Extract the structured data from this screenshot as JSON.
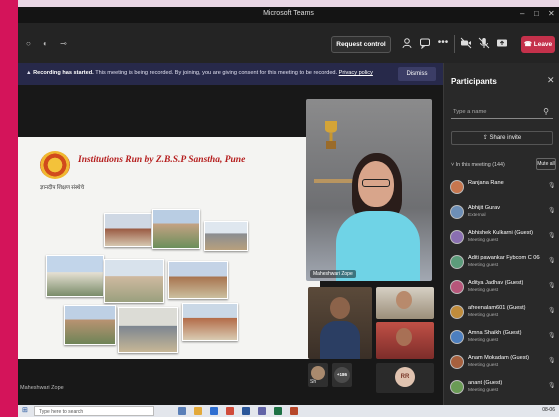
{
  "window": {
    "title": "Microsoft Teams",
    "controls": [
      "–",
      "□",
      "✕"
    ]
  },
  "toolbar": {
    "request_control_label": "Request control",
    "leave_label": "Leave",
    "icons": [
      "participants-icon",
      "chat-icon",
      "more-icon",
      "camera-icon",
      "mic-icon",
      "share-icon"
    ]
  },
  "banner": {
    "bold": "Recording has started.",
    "text": "This meeting is being recorded. By joining, you are giving consent for this meeting to be recorded.",
    "link": "Privacy policy",
    "dismiss_label": "Dismiss"
  },
  "slide": {
    "title": "Institutions Run by Z.B.S.P Sanstha, Pune",
    "subtitle": "ज्ञानदीप शिक्षण संस्थेचे"
  },
  "speaker_name": "Maheshwari Zope",
  "tiles": {
    "small_1_badge": "Sh",
    "small_2_initials": "RR",
    "small_3_badge": "+186"
  },
  "panel": {
    "title": "Participants",
    "close": "✕",
    "name_placeholder": "Type a name",
    "invite_label": "Share invite",
    "section_label": "In this meeting (144)",
    "mute_all_label": "Mute all",
    "participants": [
      {
        "name": "Ranjana Rane",
        "role": "",
        "color": "#c7764e"
      },
      {
        "name": "Abhijit Gurav",
        "role": "External",
        "color": "#6d8fb7"
      },
      {
        "name": "Abhishek Kulkarni (Guest)",
        "role": "Meeting guest",
        "color": "#8a6fb1"
      },
      {
        "name": "Aditi pawankar Fybcom C 068 (G...",
        "role": "Meeting guest",
        "color": "#5c9c7b"
      },
      {
        "name": "Aditya Jadhav (Guest)",
        "role": "Meeting guest",
        "color": "#b7567a"
      },
      {
        "name": "afreenalam601 (Guest)",
        "role": "Meeting guest",
        "color": "#c08c3c"
      },
      {
        "name": "Amna Shaikh (Guest)",
        "role": "Meeting guest",
        "color": "#4d7fbf"
      },
      {
        "name": "Anam Mokadam (Guest)",
        "role": "Meeting guest",
        "color": "#a6603e"
      },
      {
        "name": "anant (Guest)",
        "role": "Meeting guest",
        "color": "#6a9b55"
      }
    ]
  },
  "taskbar": {
    "search_placeholder": "Type here to search",
    "clock": "08-06"
  }
}
